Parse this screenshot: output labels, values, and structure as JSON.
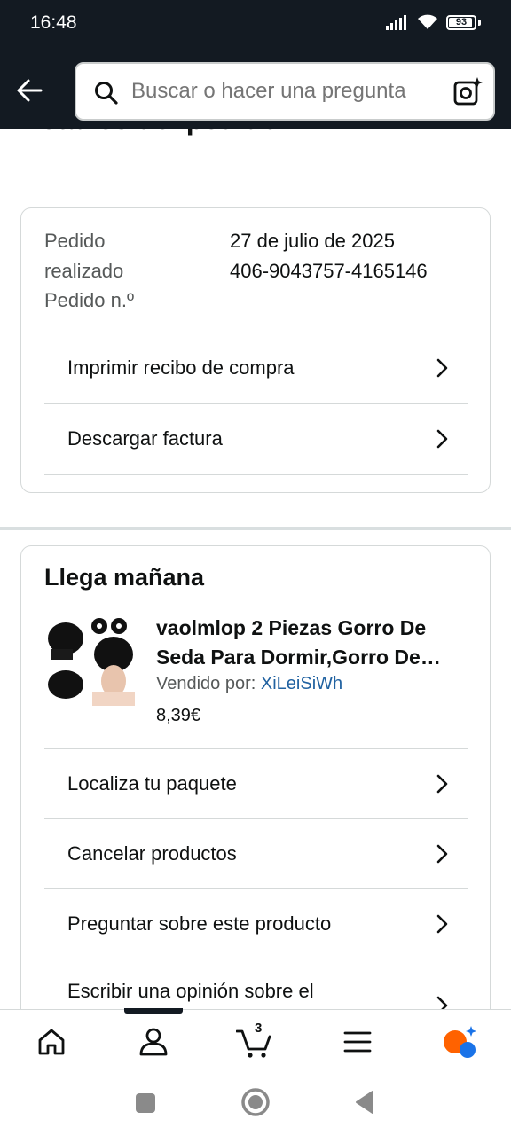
{
  "status_bar": {
    "time": "16:48",
    "battery": "93"
  },
  "header": {
    "search_placeholder": "Buscar o hacer una pregunta"
  },
  "page": {
    "title": "Detalles del pedido"
  },
  "order": {
    "labels": [
      "Pedido",
      "realizado",
      "Pedido n.º"
    ],
    "date": "27 de julio de 2025",
    "number": "406-9043757-4165146",
    "actions": [
      {
        "label": "Imprimir recibo de compra"
      },
      {
        "label": "Descargar factura"
      }
    ]
  },
  "shipment": {
    "heading": "Llega mañana",
    "product": {
      "title": "vaolmlop 2 Piezas Gorro De Seda Para Dormir,Gorro De Seda Para Dormir Mujer",
      "sold_by_label": "Vendido por:",
      "seller": "XiLeiSiWh",
      "price": "8,39€"
    },
    "actions": [
      {
        "label": "Localiza tu paquete"
      },
      {
        "label": "Cancelar productos"
      },
      {
        "label": "Preguntar sobre este producto"
      },
      {
        "label": "Escribir una opinión sobre el"
      }
    ]
  },
  "bottom_nav": {
    "cart_count": "3"
  },
  "colors": {
    "header_bg": "#131a22",
    "link": "#2162a1",
    "accent_orange": "#ff6200",
    "accent_blue": "#1a73e8"
  }
}
